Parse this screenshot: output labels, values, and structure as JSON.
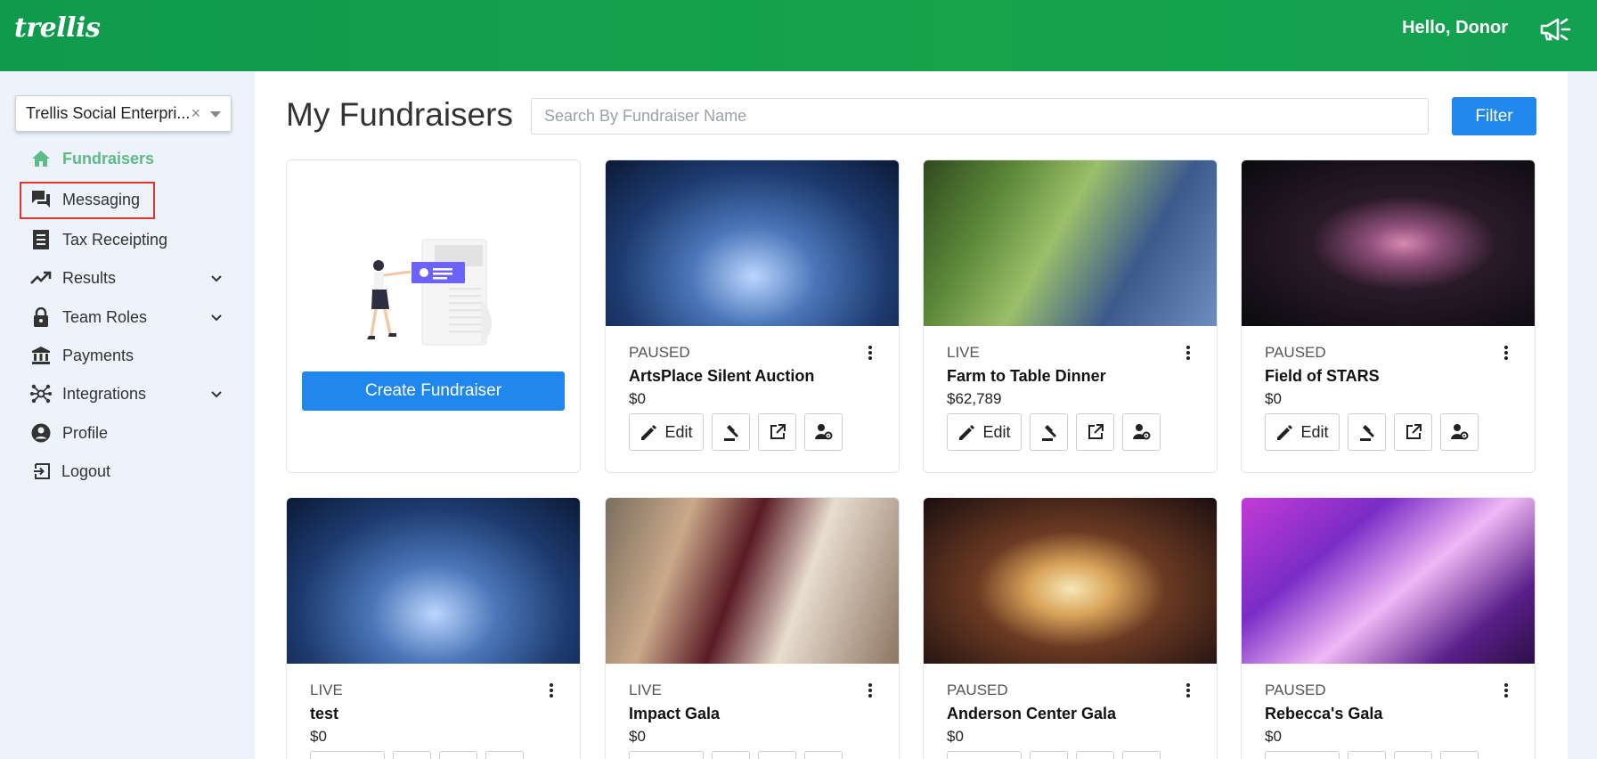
{
  "header": {
    "logo": "trellis",
    "greeting": "Hello, Donor"
  },
  "sidebar": {
    "org_select": "Trellis Social Enterpri...",
    "items": [
      {
        "label": "Fundraisers",
        "icon": "home-icon"
      },
      {
        "label": "Messaging",
        "icon": "chat-icon"
      },
      {
        "label": "Tax Receipting",
        "icon": "receipt-icon"
      },
      {
        "label": "Results",
        "icon": "trending-up-icon"
      },
      {
        "label": "Team Roles",
        "icon": "lock-icon"
      },
      {
        "label": "Payments",
        "icon": "bank-icon"
      },
      {
        "label": "Integrations",
        "icon": "hub-icon"
      },
      {
        "label": "Profile",
        "icon": "account-circle-icon"
      },
      {
        "label": "Logout",
        "icon": "logout-icon"
      }
    ]
  },
  "main": {
    "title": "My Fundraisers",
    "search_placeholder": "Search By Fundraiser Name",
    "filter_label": "Filter",
    "create_label": "Create Fundraiser",
    "edit_label": "Edit",
    "cards": [
      {
        "status": "PAUSED",
        "name": "ArtsPlace Silent Auction",
        "amount": "$0"
      },
      {
        "status": "LIVE",
        "name": "Farm to Table Dinner",
        "amount": "$62,789"
      },
      {
        "status": "PAUSED",
        "name": "Field of STARS",
        "amount": "$0"
      },
      {
        "status": "LIVE",
        "name": "test",
        "amount": "$0"
      },
      {
        "status": "LIVE",
        "name": "Impact Gala",
        "amount": "$0"
      },
      {
        "status": "PAUSED",
        "name": "Anderson Center Gala",
        "amount": "$0"
      },
      {
        "status": "PAUSED",
        "name": "Rebecca's Gala",
        "amount": "$0"
      }
    ]
  },
  "colors": {
    "header_green": "#16a34a",
    "primary_blue": "#2087ee",
    "active_nav": "#5dbb86",
    "highlight_red": "#e0362c"
  }
}
